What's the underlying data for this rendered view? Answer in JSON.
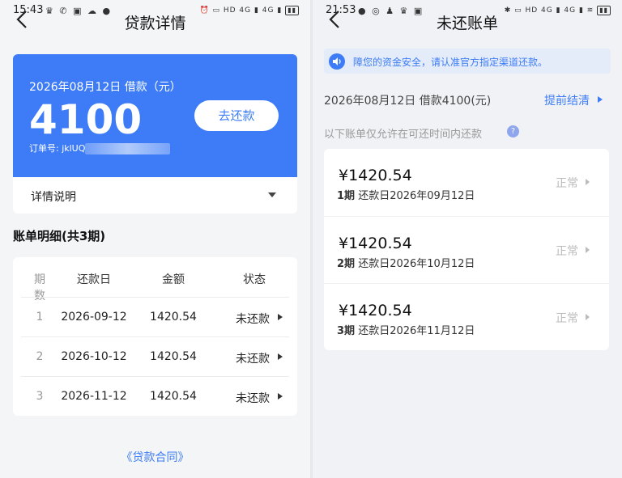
{
  "colors": {
    "accent": "#3d7cf6",
    "muted": "#999999",
    "background": "#f4f5f7"
  },
  "left": {
    "status_time": "15:43",
    "title": "贷款详情",
    "loan": {
      "date_label": "2026年08月12日 借款（元）",
      "amount": "4100",
      "order_label": "订单号: jklUQ",
      "repay_button": "去还款"
    },
    "details_label": "详情说明",
    "section_title": "账单明细(共3期)",
    "table": {
      "headers": [
        "期数",
        "还款日",
        "金额",
        "状态"
      ],
      "rows": [
        {
          "period": "1",
          "date": "2026-09-12",
          "amount": "1420.54",
          "status": "未还款"
        },
        {
          "period": "2",
          "date": "2026-10-12",
          "amount": "1420.54",
          "status": "未还款"
        },
        {
          "period": "3",
          "date": "2026-11-12",
          "amount": "1420.54",
          "status": "未还款"
        }
      ]
    },
    "contract_link": "《贷款合同》"
  },
  "right": {
    "status_time": "21:53",
    "title": "未还账单",
    "notice": "障您的资金安全，请认准官方指定渠道还款。",
    "summary": "2026年08月12日 借款4100(元)",
    "payoff_link": "提前结清",
    "only_note": "以下账单仅允许在可还时间内还款",
    "bills": [
      {
        "amount": "¥1420.54",
        "period": "1期",
        "due": "还款日2026年09月12日",
        "status": "正常"
      },
      {
        "amount": "¥1420.54",
        "period": "2期",
        "due": "还款日2026年10月12日",
        "status": "正常"
      },
      {
        "amount": "¥1420.54",
        "period": "3期",
        "due": "还款日2026年11月12日",
        "status": "正常"
      }
    ]
  }
}
